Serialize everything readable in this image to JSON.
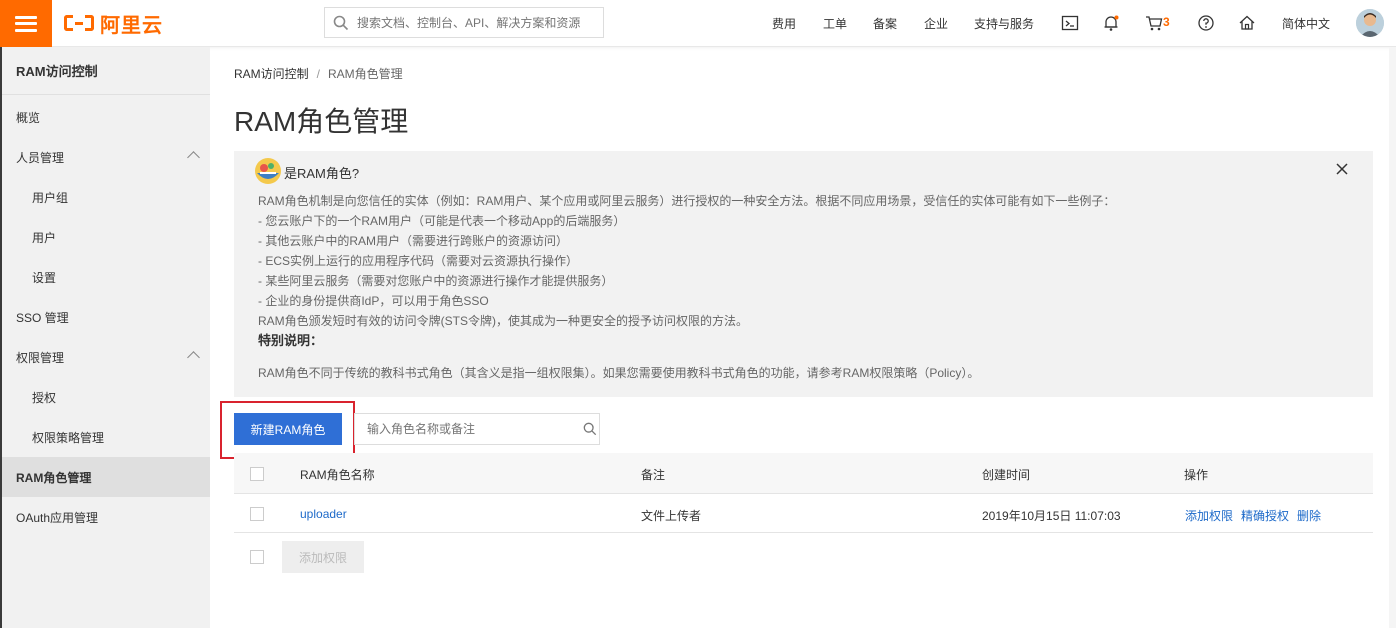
{
  "header": {
    "logo_text": "阿里云",
    "search_placeholder": "搜索文档、控制台、API、解决方案和资源",
    "nav": [
      "费用",
      "工单",
      "备案",
      "企业",
      "支持与服务"
    ],
    "cart_count": "3",
    "language": "简体中文",
    "accent_color": "#ff6a00"
  },
  "sidebar": {
    "title": "RAM访问控制",
    "items": [
      {
        "label": "概览"
      },
      {
        "label": "人员管理"
      },
      {
        "label": "用户组"
      },
      {
        "label": "用户"
      },
      {
        "label": "设置"
      },
      {
        "label": "SSO 管理"
      },
      {
        "label": "权限管理"
      },
      {
        "label": "授权"
      },
      {
        "label": "权限策略管理"
      },
      {
        "label": "RAM角色管理"
      },
      {
        "label": "OAuth应用管理"
      }
    ]
  },
  "breadcrumb": {
    "root": "RAM访问控制",
    "sep": "/",
    "current": "RAM角色管理"
  },
  "page_title": "RAM角色管理",
  "info": {
    "title": "是RAM角色?",
    "lines": [
      "RAM角色机制是向您信任的实体（例如：RAM用户、某个应用或阿里云服务）进行授权的一种安全方法。根据不同应用场景，受信任的实体可能有如下一些例子：",
      "- 您云账户下的一个RAM用户（可能是代表一个移动App的后端服务）",
      "- 其他云账户中的RAM用户（需要进行跨账户的资源访问）",
      "- ECS实例上运行的应用程序代码（需要对云资源执行操作）",
      "- 某些阿里云服务（需要对您账户中的资源进行操作才能提供服务）",
      "- 企业的身份提供商IdP，可以用于角色SSO",
      "RAM角色颁发短时有效的访问令牌(STS令牌)，使其成为一种更安全的授予访问权限的方法。"
    ],
    "special_title": "特别说明：",
    "special_text": "RAM角色不同于传统的教科书式角色（其含义是指一组权限集）。如果您需要使用教科书式角色的功能，请参考RAM权限策略（Policy）。"
  },
  "toolbar": {
    "create_label": "新建RAM角色",
    "filter_placeholder": "输入角色名称或备注"
  },
  "table": {
    "columns": [
      "RAM角色名称",
      "备注",
      "创建时间",
      "操作"
    ],
    "rows": [
      {
        "name": "uploader",
        "note": "文件上传者",
        "created": "2019年10月15日 11:07:03",
        "actions": [
          "添加权限",
          "精确授权",
          "删除"
        ]
      }
    ],
    "bulk_add_label": "添加权限"
  }
}
